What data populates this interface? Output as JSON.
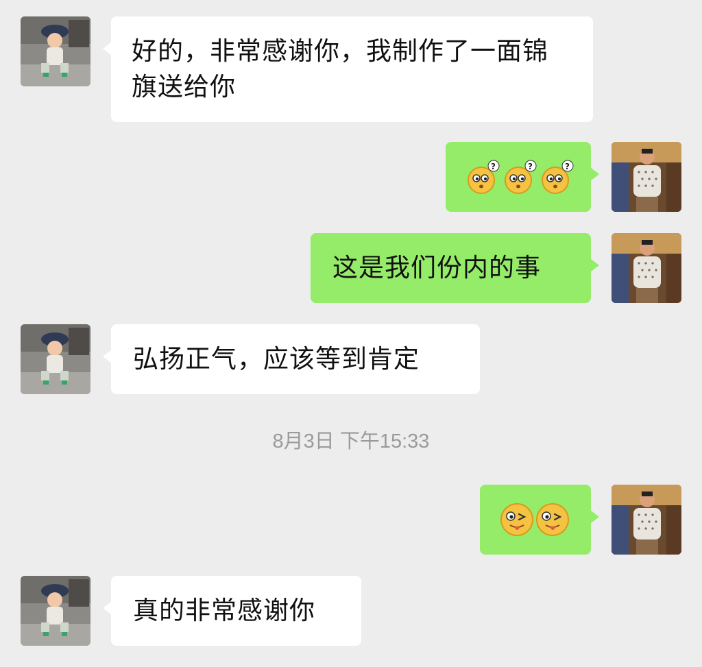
{
  "messages": [
    {
      "side": "left",
      "type": "text",
      "text": "好的，非常感谢你，我制作了一面锦旗送给你"
    },
    {
      "side": "right",
      "type": "emoji",
      "emoji": [
        "confused-face-emoji",
        "confused-face-emoji",
        "confused-face-emoji"
      ]
    },
    {
      "side": "right",
      "type": "text",
      "text": "这是我们份内的事"
    },
    {
      "side": "left",
      "type": "text",
      "text": "弘扬正气，应该等到肯定"
    },
    {
      "side": "right",
      "type": "emoji",
      "emoji": [
        "wink-tongue-emoji",
        "wink-tongue-emoji"
      ]
    },
    {
      "side": "left",
      "type": "text",
      "text": "真的非常感谢你"
    }
  ],
  "timestamp": "8月3日 下午15:33",
  "colors": {
    "background": "#ededed",
    "left_bubble": "#ffffff",
    "right_bubble": "#95ec69",
    "timestamp_text": "#9a9a9a"
  }
}
